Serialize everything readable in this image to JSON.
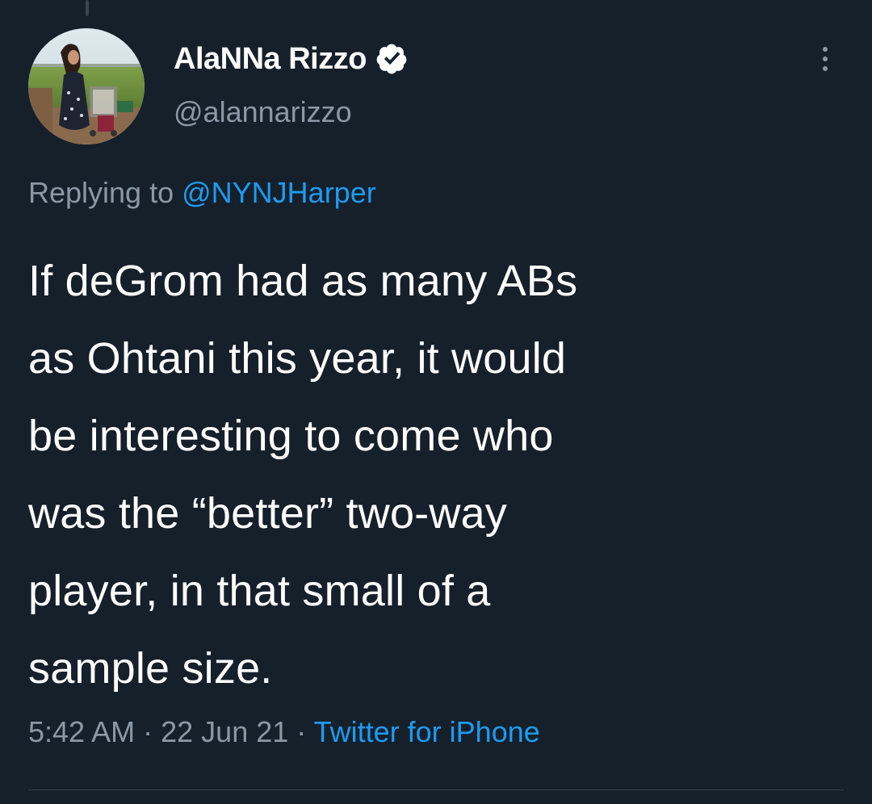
{
  "tweet": {
    "author": {
      "display_name": "AlaNNa Rizzo",
      "handle": "@alannarizzo",
      "verified": true
    },
    "reply_prefix": "Replying to",
    "reply_to": "@NYNJHarper",
    "text_lines": [
      "If deGrom had as many ABs",
      "as Ohtani this year, it would",
      "be interesting to come who",
      "was the “better” two-way",
      "player, in that small of a",
      "sample size."
    ],
    "time": "5:42 AM",
    "separator": "·",
    "date": "22 Jun 21",
    "source": "Twitter for iPhone"
  },
  "icons": {
    "verified": "verified-badge-icon",
    "more": "more-options-icon"
  },
  "colors": {
    "background": "#15202b",
    "primary_text": "#ffffff",
    "secondary_text": "#8b98a5",
    "accent": "#1d9bf0"
  }
}
